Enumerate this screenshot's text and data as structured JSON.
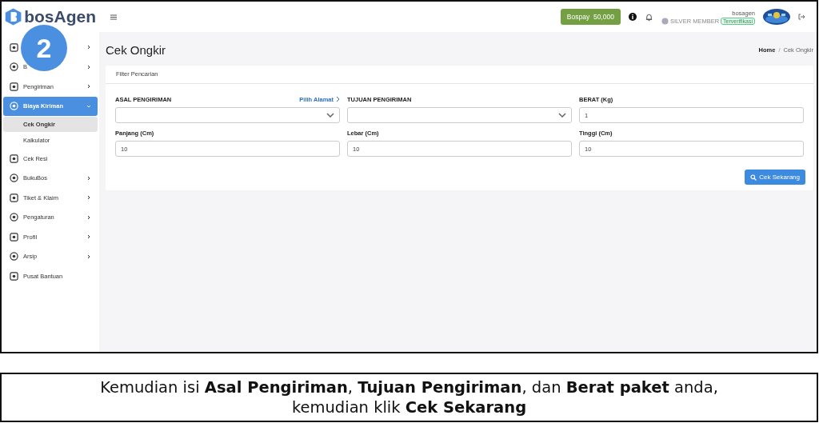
{
  "step_badge": "2",
  "logo": {
    "text": "bosAgen"
  },
  "topbar": {
    "balance_button": "Bospay  50,000",
    "membership": "SILVER MEMBER",
    "verified_badge": "Terverifikasi",
    "username": "bosagen"
  },
  "sidebar": {
    "items": [
      {
        "expanded": false,
        "selected": false
      },
      {
        "label": "B",
        "expanded": false,
        "selected": false
      },
      {
        "label": "Pengiriman",
        "expanded": false,
        "selected": false
      },
      {
        "label": "Biaya Kiriman",
        "expanded": true,
        "selected": true,
        "children": [
          {
            "label": "Cek Ongkir",
            "selected": true
          },
          {
            "label": "Kalkulator",
            "selected": false
          }
        ]
      },
      {
        "label": "Cek Resi",
        "selected": false
      },
      {
        "label": "BukuBos",
        "expanded": false,
        "selected": false
      },
      {
        "label": "Tiket & Klaim",
        "expanded": false,
        "selected": false
      },
      {
        "label": "Pengaturan",
        "expanded": false,
        "selected": false
      },
      {
        "label": "Profil",
        "expanded": false,
        "selected": false
      },
      {
        "label": "Arsip",
        "expanded": false,
        "selected": false
      },
      {
        "label": "Pusat Bantuan",
        "selected": false
      }
    ]
  },
  "page": {
    "title": "Cek Ongkir",
    "breadcrumb_separator": "/",
    "breadcrumb": [
      {
        "label": "Home"
      },
      {
        "label": "Cek Ongkir"
      }
    ]
  },
  "card": {
    "title": "Filter Pencarian",
    "fields": [
      {
        "kind": "select",
        "label": "ASAL PENGIRIMAN",
        "link": "Pilih Alamat"
      },
      {
        "kind": "select",
        "label": "TUJUAN PENGIRIMAN"
      },
      {
        "kind": "input",
        "label": "BERAT (Kg)",
        "value": "1"
      },
      {
        "kind": "input",
        "label": "Panjang (Cm)",
        "value": "10"
      },
      {
        "kind": "input",
        "label": "Lebar (Cm)",
        "value": "10"
      },
      {
        "kind": "input",
        "label": "Tinggi (Cm)",
        "value": "10"
      }
    ],
    "submit_button": "Cek Sekarang"
  },
  "caption": "Kemudian isi **Asal Pengiriman**, **Tujuan Pengiriman**, dan **Berat paket** anda, kemudian klik **Cek Sekarang**"
}
